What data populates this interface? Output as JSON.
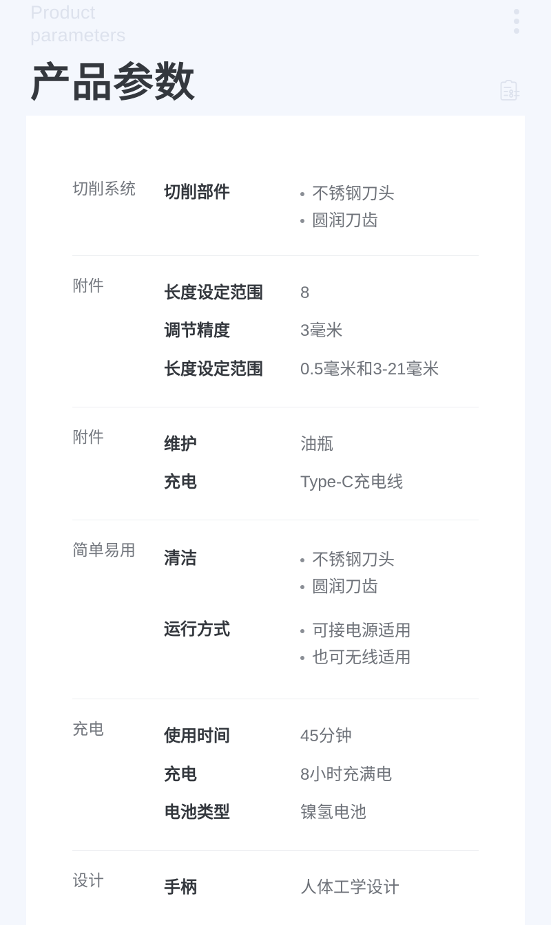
{
  "header": {
    "eyebrow": "Product\nparameters",
    "menu_icon": "kebab-menu-icon",
    "title": "产品参数",
    "title_icon": "clipboard-spec-icon"
  },
  "colors": {
    "page_background": "#f4f7fd",
    "card_background": "#ffffff",
    "title_text": "#34383e",
    "eyebrow_text": "#dde2ed",
    "category_text": "#73777e",
    "label_text": "#33373d",
    "value_text": "#6e7279",
    "divider": "#eceef1",
    "bullet": "#8a8e95"
  },
  "spec_groups": [
    {
      "category": "切削系统",
      "rows": [
        {
          "label": "切削部件",
          "values": [
            "不锈钢刀头",
            "圆润刀齿"
          ],
          "bulleted": true
        }
      ]
    },
    {
      "category": "附件",
      "rows": [
        {
          "label": "长度设定范围",
          "value": "8",
          "bulleted": false
        },
        {
          "label": "调节精度",
          "value": "3毫米",
          "bulleted": false
        },
        {
          "label": "长度设定范围",
          "value": "0.5毫米和3-21毫米",
          "bulleted": false
        }
      ]
    },
    {
      "category": "附件",
      "rows": [
        {
          "label": "维护",
          "value": "油瓶",
          "bulleted": false
        },
        {
          "label": "充电",
          "value": "Type-C充电线",
          "bulleted": false
        }
      ]
    },
    {
      "category": "简单易用",
      "rows": [
        {
          "label": "清洁",
          "values": [
            "不锈钢刀头",
            "圆润刀齿"
          ],
          "bulleted": true
        },
        {
          "label": "运行方式",
          "values": [
            "可接电源适用",
            "也可无线适用"
          ],
          "bulleted": true
        }
      ]
    },
    {
      "category": "充电",
      "rows": [
        {
          "label": "使用时间",
          "value": "45分钟",
          "bulleted": false
        },
        {
          "label": "充电",
          "value": "8小时充满电",
          "bulleted": false
        },
        {
          "label": "电池类型",
          "value": "镍氢电池",
          "bulleted": false
        }
      ]
    },
    {
      "category": "设计",
      "rows": [
        {
          "label": "手柄",
          "value": "人体工学设计",
          "bulleted": false
        }
      ]
    }
  ]
}
